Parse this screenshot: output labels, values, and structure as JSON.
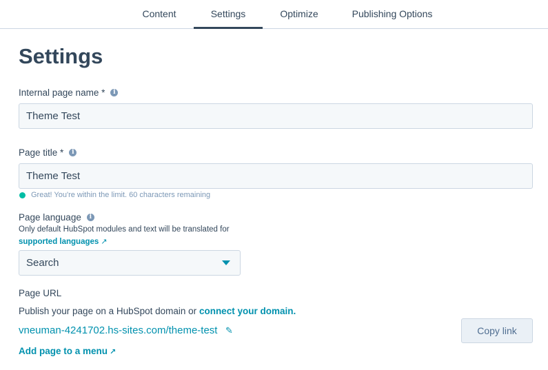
{
  "tabs": [
    {
      "label": "Content"
    },
    {
      "label": "Settings"
    },
    {
      "label": "Optimize"
    },
    {
      "label": "Publishing Options"
    }
  ],
  "page_title": "Settings",
  "internal_name": {
    "label": "Internal page name *",
    "value": "Theme Test"
  },
  "page_title_field": {
    "label": "Page title *",
    "value": "Theme Test",
    "hint": "Great! You're within the limit. 60 characters remaining"
  },
  "language": {
    "label": "Page language",
    "description": "Only default HubSpot modules and text will be translated for",
    "link": "supported languages",
    "select_value": "Search"
  },
  "url": {
    "label": "Page URL",
    "description": "Publish your page on a HubSpot domain or",
    "connect_link": "connect your domain.",
    "address": "vneuman-4241702.hs-sites.com/theme-test",
    "copy_label": "Copy link",
    "menu_link": "Add page to a menu"
  },
  "colors": {
    "accent": "#0091ae",
    "text": "#33475b",
    "success": "#00bda5"
  }
}
